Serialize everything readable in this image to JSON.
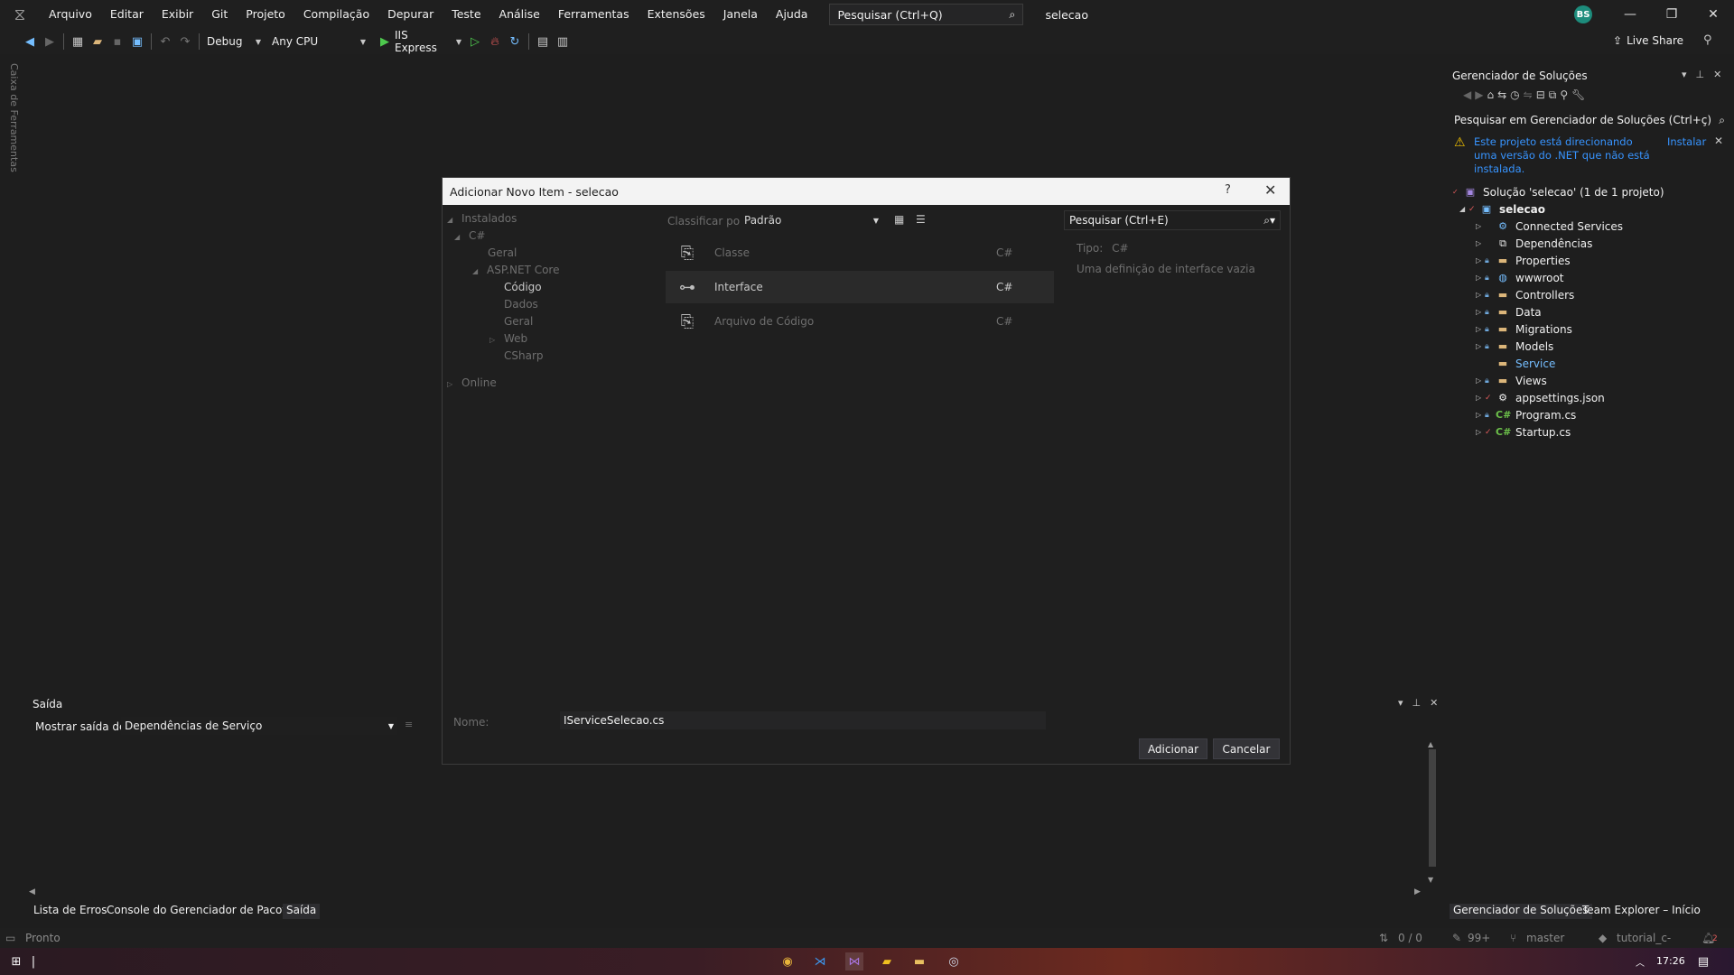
{
  "menu": {
    "items": [
      "Arquivo",
      "Editar",
      "Exibir",
      "Git",
      "Projeto",
      "Compilação",
      "Depurar",
      "Teste",
      "Análise",
      "Ferramentas",
      "Extensões",
      "Janela",
      "Ajuda"
    ],
    "search_placeholder": "Pesquisar (Ctrl+Q)",
    "solution_name": "selecao",
    "avatar_initials": "BS"
  },
  "toolbar": {
    "config": "Debug",
    "platform": "Any CPU",
    "run_target": "IIS Express",
    "live_share": "Live Share"
  },
  "toolbox_tab": "Caixa de Ferramentas",
  "dialog": {
    "title": "Adicionar Novo Item - selecao",
    "help": "?",
    "tree": [
      {
        "label": "Instalados",
        "caret": "◢"
      },
      {
        "label": "C#",
        "caret": "◢"
      },
      {
        "label": "Geral",
        "caret": ""
      },
      {
        "label": "ASP.NET Core",
        "caret": "◢"
      },
      {
        "label": "Código",
        "caret": ""
      },
      {
        "label": "Dados",
        "caret": ""
      },
      {
        "label": "Geral",
        "caret": ""
      },
      {
        "label": "Web",
        "caret": "▷"
      },
      {
        "label": "CSharp",
        "caret": ""
      },
      {
        "label": "Online",
        "caret": "▷"
      }
    ],
    "sort_label": "Classificar por:",
    "sort_value": "Padrão",
    "search_placeholder": "Pesquisar (Ctrl+E)",
    "templates": [
      {
        "name": "Classe",
        "lang": "C#",
        "selected": false
      },
      {
        "name": "Interface",
        "lang": "C#",
        "selected": true
      },
      {
        "name": "Arquivo de Código",
        "lang": "C#",
        "selected": false
      }
    ],
    "type_label": "Tipo:",
    "type_value": "C#",
    "type_description": "Uma definição de interface vazia",
    "name_label": "Nome:",
    "name_value": "IServiceSelecao.cs",
    "add_button": "Adicionar",
    "cancel_button": "Cancelar"
  },
  "solution_explorer": {
    "title": "Gerenciador de Soluções",
    "search_placeholder": "Pesquisar em Gerenciador de Soluções (Ctrl+ç)",
    "warning_text": "Este projeto está direcionando uma versão do .NET que não está instalada.",
    "warning_action": "Instalar",
    "solution_label": "Solução 'selecao' (1 de 1 projeto)",
    "project": "selecao",
    "items": [
      "Connected Services",
      "Dependências",
      "Properties",
      "wwwroot",
      "Controllers",
      "Data",
      "Migrations",
      "Models",
      "Service",
      "Views",
      "appsettings.json",
      "Program.cs",
      "Startup.cs"
    ]
  },
  "output": {
    "title": "Saída",
    "show_from_label": "Mostrar saída de:",
    "show_from_value": "Dependências de Serviço"
  },
  "bottom_tabs": {
    "left": [
      "Lista de Erros",
      "Console do Gerenciador de Pacotes",
      "Saída"
    ],
    "right": [
      "Gerenciador de Soluções",
      "Team Explorer – Início"
    ]
  },
  "status": {
    "state": "Pronto",
    "changes": "0 / 0",
    "edits": "99+",
    "branch": "master",
    "repo": "tutorial_c-",
    "notifications": "2"
  },
  "taskbar": {
    "clock": "17:26"
  }
}
